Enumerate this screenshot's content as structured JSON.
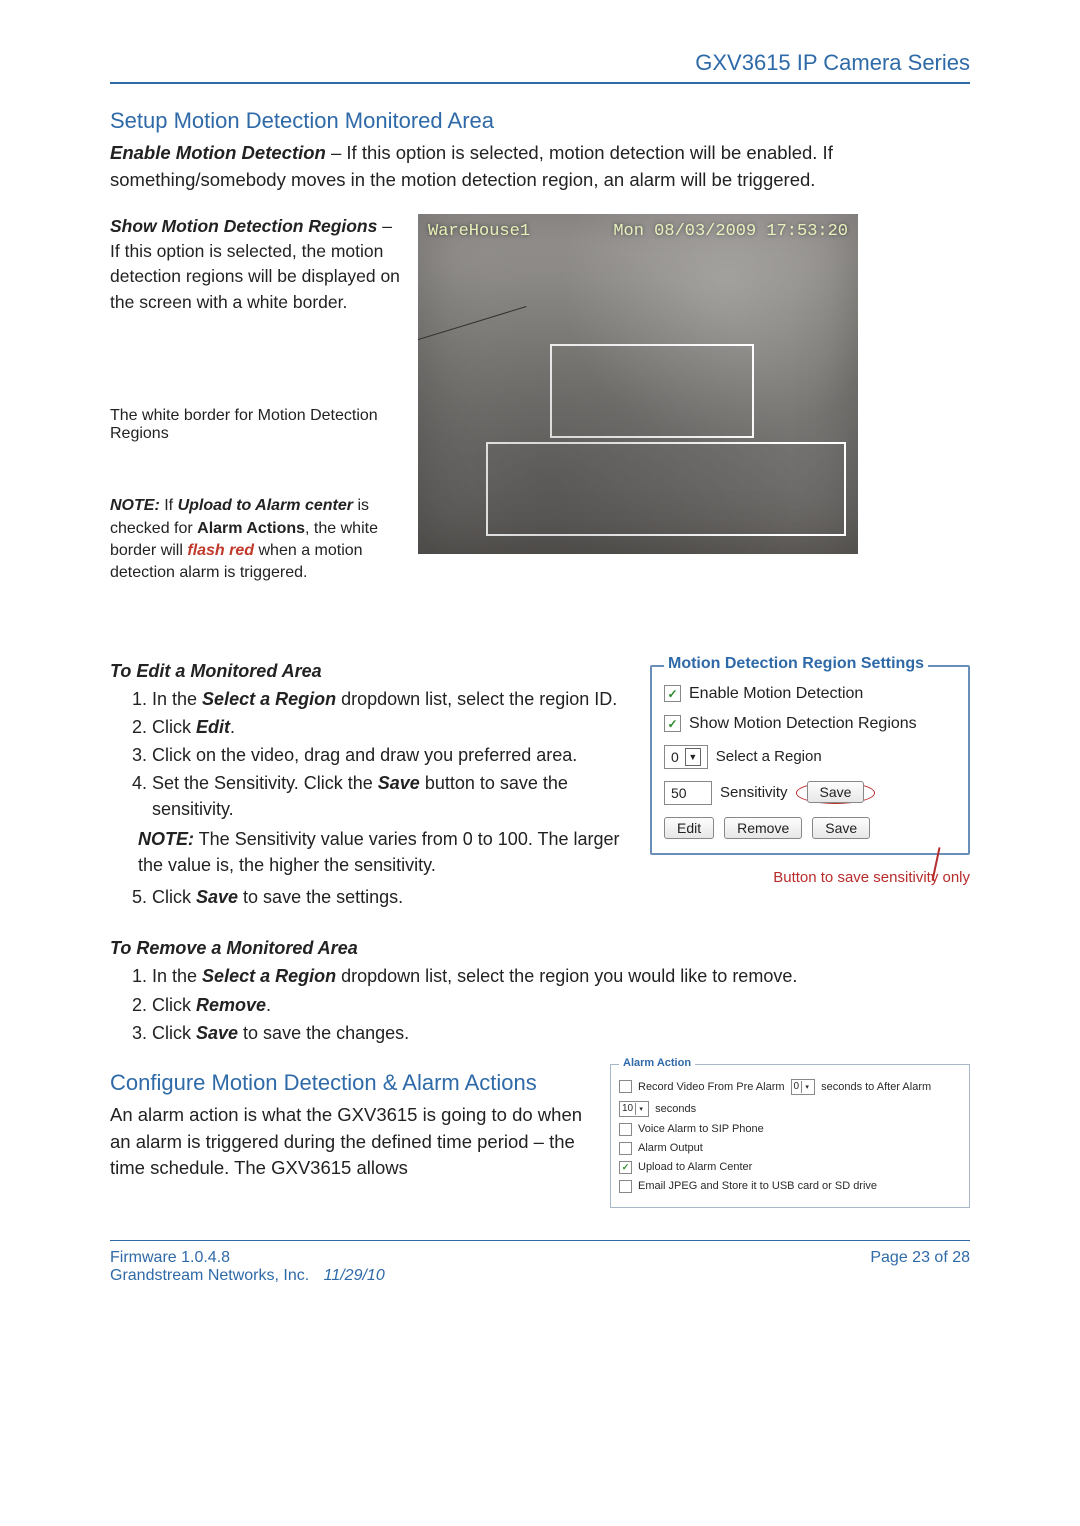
{
  "header": {
    "product": "GXV3615 IP Camera Series"
  },
  "section1": {
    "heading": "Setup Motion Detection Monitored Area",
    "enable_md_label": "Enable Motion Detection",
    "enable_md_text": " – If this option is selected, motion detection will be enabled. If something/somebody moves in the motion detection region, an alarm will be triggered.",
    "show_md_label": "Show Motion Detection Regions",
    "show_md_text": " – If this option is selected, the motion detection regions will be displayed on the screen with a white border.",
    "border_annot": "The white border for Motion Detection Regions",
    "note_label": "NOTE:",
    "note_pre": "  If ",
    "note_upload": "Upload to Alarm center",
    "note_mid1": " is checked for ",
    "note_alarm_actions": "Alarm Actions",
    "note_mid2": ", the white border will ",
    "note_flash": "flash red",
    "note_post": " when a motion detection alarm is triggered."
  },
  "camera": {
    "overlay_name": "WareHouse1",
    "overlay_time": "Mon 08/03/2009 17:53:20"
  },
  "edit": {
    "heading": "To Edit a Monitored Area",
    "step1a": "In the ",
    "step1b": "Select a Region",
    "step1c": " dropdown list, select the region ID.",
    "step2a": "Click ",
    "step2b": "Edit",
    "step2c": ".",
    "step3": "Click on the video, drag and draw you preferred area.",
    "step4a": "Set the Sensitivity. Click the ",
    "step4b": "Save",
    "step4c": " button to save the sensitivity.",
    "note_label": "NOTE:",
    "note_text": " The Sensitivity value varies from 0 to 100. The larger the value is, the higher the sensitivity.",
    "step5a": "Click ",
    "step5b": "Save",
    "step5c": " to save the settings."
  },
  "panel": {
    "legend": "Motion Detection Region Settings",
    "enable_md": "Enable Motion Detection",
    "show_md": "Show Motion Detection Regions",
    "region_value": "0",
    "select_region_label": "Select a Region",
    "sensitivity_value": "50",
    "sensitivity_label": "Sensitivity",
    "save_sens": "Save",
    "btn_edit": "Edit",
    "btn_remove": "Remove",
    "btn_save": "Save",
    "sens_annot": "Button to save sensitivity only"
  },
  "remove": {
    "heading": "To Remove a Monitored Area",
    "step1a": "In the ",
    "step1b": "Select a Region",
    "step1c": " dropdown list, select the region you would like to remove.",
    "step2a": "Click ",
    "step2b": "Remove",
    "step2c": ".",
    "step3a": "Click ",
    "step3b": "Save",
    "step3c": " to save the changes."
  },
  "configure": {
    "heading": "Configure Motion Detection & Alarm Actions",
    "text": "An alarm action is what the GXV3615 is going to do when an alarm is triggered during the defined time period – the time schedule. The GXV3615 allows"
  },
  "alarm_panel": {
    "legend": "Alarm Action",
    "row1_a": "Record Video From Pre Alarm",
    "row1_pre": "0",
    "row1_b": "seconds  to After Alarm",
    "row1_post": "10",
    "row1_c": "seconds",
    "row2": "Voice Alarm to SIP Phone",
    "row3": "Alarm Output",
    "row4": "Upload to Alarm Center",
    "row5": "Email JPEG and Store it to USB card or SD drive"
  },
  "footer": {
    "firmware": "Firmware 1.0.4.8",
    "company": "Grandstream Networks, Inc.",
    "date": "11/29/10",
    "page": "Page 23 of 28"
  }
}
